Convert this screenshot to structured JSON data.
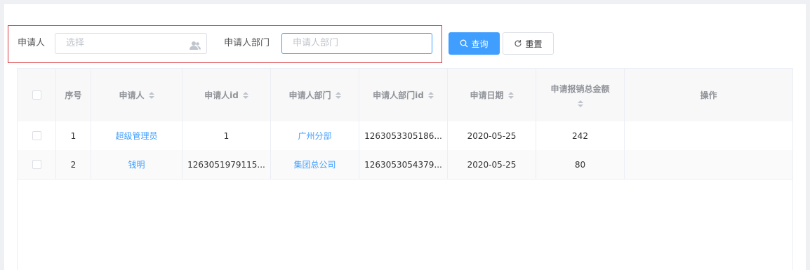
{
  "search": {
    "applicant_label": "申请人",
    "applicant_placeholder": "选择",
    "dept_label": "申请人部门",
    "dept_placeholder": "申请人部门",
    "search_button": "查询",
    "reset_button": "重置"
  },
  "table": {
    "headers": {
      "index": "序号",
      "applicant": "申请人",
      "applicant_id": "申请人id",
      "dept": "申请人部门",
      "dept_id": "申请人部门id",
      "date": "申请日期",
      "amount": "申请报销总金额",
      "actions": "操作"
    },
    "rows": [
      {
        "index": "1",
        "applicant": "超级管理员",
        "applicant_id": "1",
        "dept": "广州分部",
        "dept_id": "1263053305186...",
        "date": "2020-05-25",
        "amount": "242"
      },
      {
        "index": "2",
        "applicant": "钱明",
        "applicant_id": "1263051979115...",
        "dept": "集团总公司",
        "dept_id": "1263053054379...",
        "date": "2020-05-25",
        "amount": "80"
      }
    ]
  },
  "colors": {
    "primary": "#409eff",
    "highlight_border": "#d9363e"
  },
  "icons": {
    "applicant_suffix": "user-group-icon",
    "search": "search-icon",
    "reset": "refresh-icon"
  }
}
